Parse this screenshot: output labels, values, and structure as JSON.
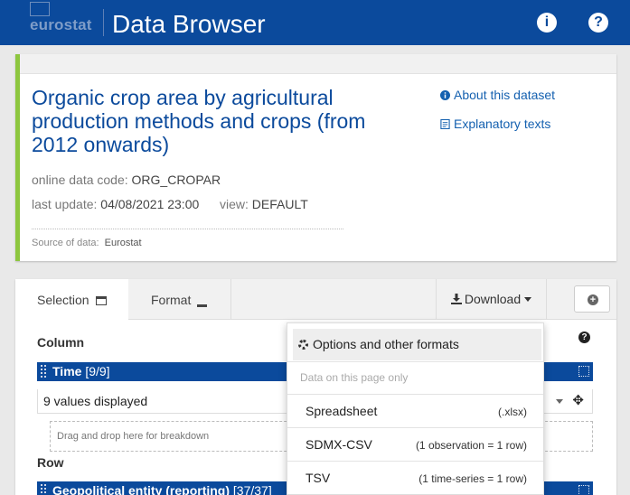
{
  "header": {
    "logo_text": "eurostat",
    "app_title": "Data Browser",
    "info_icon": "info-icon",
    "help_icon": "help-icon"
  },
  "dataset": {
    "title": "Organic crop area by agricultural production methods and crops (from 2012 onwards)",
    "code_label": "online data code:",
    "code_value": "ORG_CROPAR",
    "update_label": "last update:",
    "update_value": "04/08/2021 23:00",
    "view_label": "view:",
    "view_value": "DEFAULT",
    "source_label": "Source of data:",
    "source_value": "Eurostat",
    "about_link": "About this dataset",
    "explanatory_link": "Explanatory texts"
  },
  "tabs": {
    "selection": "Selection",
    "format": "Format",
    "download": "Download"
  },
  "layout": {
    "column_label": "Column",
    "row_label": "Row",
    "time_dim_name": "Time",
    "time_dim_count": "[9/9]",
    "time_values_text": "9 values displayed",
    "dropzone_text": "Drag and drop here for breakdown",
    "geo_dim_name": "Geopolitical entity (reporting)",
    "geo_dim_count": "[37/37]"
  },
  "download_menu": {
    "options_label": "Options and other formats",
    "hint": "Data on this page only",
    "formats": [
      {
        "name": "Spreadsheet",
        "note": "(.xlsx)"
      },
      {
        "name": "SDMX-CSV",
        "note": "(1 observation = 1 row)"
      },
      {
        "name": "TSV",
        "note": "(1 time-series = 1 row)"
      }
    ]
  },
  "colors": {
    "brand_blue": "#0b4a9c",
    "accent_green": "#8dc63f",
    "link_blue": "#1561b0"
  }
}
